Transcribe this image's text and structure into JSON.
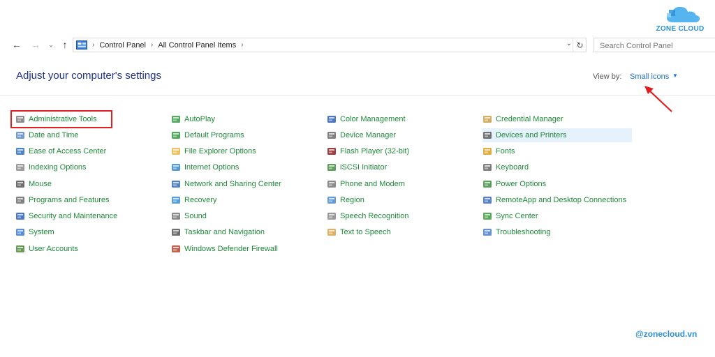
{
  "logo": {
    "text": "ZONE CLOUD"
  },
  "address": {
    "crumbs": [
      "Control Panel",
      "All Control Panel Items"
    ],
    "search_placeholder": "Search Control Panel"
  },
  "heading": "Adjust your computer's settings",
  "view_by": {
    "label": "View by:",
    "value": "Small icons"
  },
  "columns": [
    [
      {
        "label": "Administrative Tools",
        "icon": "admin-tools-icon",
        "color": "#7a7a7a"
      },
      {
        "label": "Date and Time",
        "icon": "clock-icon",
        "color": "#5b8bd0"
      },
      {
        "label": "Ease of Access Center",
        "icon": "ease-of-access-icon",
        "color": "#2d6fc2"
      },
      {
        "label": "Indexing Options",
        "icon": "magnifier-icon",
        "color": "#8a8a8a"
      },
      {
        "label": "Mouse",
        "icon": "mouse-icon",
        "color": "#555555"
      },
      {
        "label": "Programs and Features",
        "icon": "programs-icon",
        "color": "#6b6b6b"
      },
      {
        "label": "Security and Maintenance",
        "icon": "flag-icon",
        "color": "#2a5fc0"
      },
      {
        "label": "System",
        "icon": "monitor-icon",
        "color": "#3a7bd5"
      },
      {
        "label": "User Accounts",
        "icon": "users-icon",
        "color": "#4f8a3a"
      }
    ],
    [
      {
        "label": "AutoPlay",
        "icon": "autoplay-icon",
        "color": "#3a9a4a"
      },
      {
        "label": "Default Programs",
        "icon": "default-programs-icon",
        "color": "#2f9a3f"
      },
      {
        "label": "File Explorer Options",
        "icon": "folder-icon",
        "color": "#e6b84a"
      },
      {
        "label": "Internet Options",
        "icon": "globe-icon",
        "color": "#3a87c9"
      },
      {
        "label": "Network and Sharing Center",
        "icon": "network-icon",
        "color": "#3a6fb5"
      },
      {
        "label": "Recovery",
        "icon": "recovery-icon",
        "color": "#3a8fd0"
      },
      {
        "label": "Sound",
        "icon": "speaker-icon",
        "color": "#777777"
      },
      {
        "label": "Taskbar and Navigation",
        "icon": "taskbar-icon",
        "color": "#555555"
      },
      {
        "label": "Windows Defender Firewall",
        "icon": "firewall-icon",
        "color": "#b5462f"
      }
    ],
    [
      {
        "label": "Color Management",
        "icon": "color-management-icon",
        "color": "#2b5fb5"
      },
      {
        "label": "Device Manager",
        "icon": "device-manager-icon",
        "color": "#6a6a6a"
      },
      {
        "label": "Flash Player (32-bit)",
        "icon": "flash-icon",
        "color": "#8a1e1e"
      },
      {
        "label": "iSCSI Initiator",
        "icon": "iscsi-icon",
        "color": "#3f8f3f"
      },
      {
        "label": "Phone and Modem",
        "icon": "phone-icon",
        "color": "#777777"
      },
      {
        "label": "Region",
        "icon": "region-icon",
        "color": "#4a8bd0"
      },
      {
        "label": "Speech Recognition",
        "icon": "microphone-icon",
        "color": "#888888"
      },
      {
        "label": "Text to Speech",
        "icon": "text-to-speech-icon",
        "color": "#d9a34a"
      }
    ],
    [
      {
        "label": "Credential Manager",
        "icon": "credential-icon",
        "color": "#c9a14a"
      },
      {
        "label": "Devices and Printers",
        "icon": "printer-icon",
        "color": "#5a5a5a"
      },
      {
        "label": "Fonts",
        "icon": "fonts-icon",
        "color": "#d9a020"
      },
      {
        "label": "Keyboard",
        "icon": "keyboard-icon",
        "color": "#6a6a6a"
      },
      {
        "label": "Power Options",
        "icon": "power-icon",
        "color": "#3f8f3f"
      },
      {
        "label": "RemoteApp and Desktop Connections",
        "icon": "remoteapp-icon",
        "color": "#3a6fb5"
      },
      {
        "label": "Sync Center",
        "icon": "sync-icon",
        "color": "#3a9a3a"
      },
      {
        "label": "Troubleshooting",
        "icon": "troubleshooting-icon",
        "color": "#4a7fc9"
      }
    ]
  ],
  "watermark": "@zonecloud.vn"
}
